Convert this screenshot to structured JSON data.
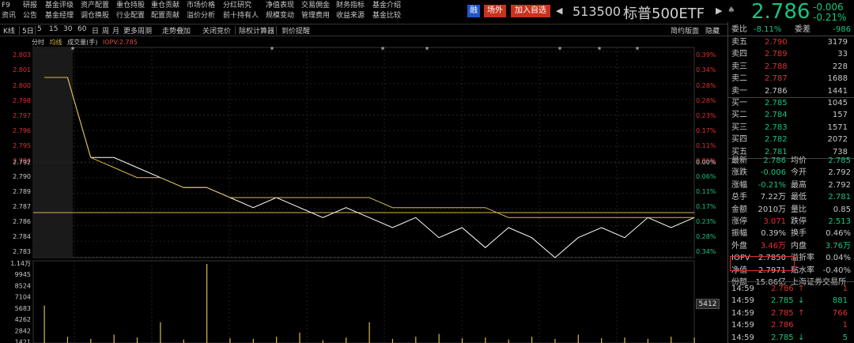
{
  "nav": {
    "row1": [
      "F9",
      "研报",
      "基金评级",
      "资产配置",
      "重仓持股",
      "重仓贡献",
      "市场价格",
      "分红研究",
      "净值表现",
      "交易佣金",
      "财务指标",
      "基金介绍"
    ],
    "row2": [
      "资讯",
      "公告",
      "基金经理",
      "调仓换股",
      "行业配置",
      "配置贡献",
      "溢价分析",
      "前十持有人",
      "规模变动",
      "管理费用",
      "收益来源",
      "基金比较"
    ]
  },
  "header": {
    "rong": "融",
    "changwai": "场外",
    "add_watch": "加入自选",
    "code": "513500",
    "name": "标普500ETF",
    "price": "2.786",
    "change": "-0.006",
    "change_pct": "-0.21%",
    "colors": {
      "up": "#e03030",
      "down": "#19c37d",
      "accent_blue": "#1e56c8",
      "accent_red": "#c8321e"
    }
  },
  "toolbar": {
    "items": [
      "K线",
      "5日",
      "5",
      "15",
      "30",
      "60",
      "日",
      "周",
      "月",
      "更多周期",
      "走势叠加",
      "关闭竞价",
      "除权计算器",
      "到价提醒"
    ],
    "right": [
      "简约版面",
      "隐藏"
    ]
  },
  "legend": {
    "fenshi": "分时",
    "junxian": "均线",
    "volume": "成交量(手)",
    "iopv": "IOPV:2.785"
  },
  "price_axis": {
    "left": [
      "2.803",
      "2.801",
      "2.800",
      "2.798",
      "2.797",
      "2.796",
      "2.795",
      "2.794",
      "2.792",
      "2.790",
      "2.789",
      "2.787",
      "2.786",
      "2.784",
      "2.783"
    ],
    "right": [
      "0.39%",
      "0.34%",
      "0.28%",
      "0.28%",
      "0.23%",
      "0.17%",
      "0.11%",
      "0.06%",
      "0.00%",
      "0.06%",
      "0.11%",
      "0.17%",
      "0.23%",
      "0.28%",
      "0.34%"
    ]
  },
  "volume_axis": {
    "labels": [
      "1.14万",
      "9945",
      "8524",
      "7104",
      "5683",
      "4262",
      "2842",
      "1421"
    ],
    "current": "5412"
  },
  "chart_data": {
    "type": "line",
    "title": "",
    "series": [
      {
        "name": "分时",
        "color": "#ffffff",
        "values": [
          2.8,
          2.8,
          2.792,
          2.792,
          2.791,
          2.79,
          2.789,
          2.789,
          2.788,
          2.787,
          2.788,
          2.787,
          2.786,
          2.787,
          2.786,
          2.785,
          2.786,
          2.784,
          2.785,
          2.783,
          2.785,
          2.784,
          2.782,
          2.784,
          2.785,
          2.784,
          2.786,
          2.785,
          2.786
        ]
      },
      {
        "name": "均线",
        "color": "#d8b84a",
        "values": [
          2.8,
          2.8,
          2.792,
          2.791,
          2.79,
          2.79,
          2.789,
          2.789,
          2.788,
          2.788,
          2.788,
          2.788,
          2.788,
          2.788,
          2.788,
          2.787,
          2.787,
          2.787,
          2.787,
          2.787,
          2.786,
          2.786,
          2.786,
          2.786,
          2.786,
          2.786,
          2.786,
          2.786,
          2.786
        ]
      }
    ],
    "ylim": [
      2.782,
      2.803
    ],
    "volume": [
      5412,
      900,
      600,
      1200,
      800,
      3000,
      500,
      11400,
      700,
      600,
      900,
      1500,
      400,
      800,
      3000,
      600,
      900,
      1300,
      700,
      800,
      500,
      900,
      600,
      1200,
      700,
      800,
      600,
      900,
      800
    ]
  },
  "orderbook": {
    "weibi": {
      "label": "委比",
      "value": "-8.11%"
    },
    "weicha": {
      "label": "委差",
      "value": "-986"
    },
    "asks": [
      {
        "label": "卖五",
        "price": "2.790",
        "vol": "3179"
      },
      {
        "label": "卖四",
        "price": "2.789",
        "vol": "33"
      },
      {
        "label": "卖三",
        "price": "2.788",
        "vol": "228"
      },
      {
        "label": "卖二",
        "price": "2.787",
        "vol": "1688"
      },
      {
        "label": "卖一",
        "price": "2.786",
        "vol": "1441"
      }
    ],
    "bids": [
      {
        "label": "买一",
        "price": "2.785",
        "vol": "1045"
      },
      {
        "label": "买二",
        "price": "2.784",
        "vol": "157"
      },
      {
        "label": "买三",
        "price": "2.783",
        "vol": "1571"
      },
      {
        "label": "买四",
        "price": "2.782",
        "vol": "2072"
      },
      {
        "label": "买五",
        "price": "2.781",
        "vol": "738"
      }
    ]
  },
  "stats": [
    {
      "l1": "最新",
      "v1": "2.786",
      "c1": "down",
      "l2": "均价",
      "v2": "2.785",
      "c2": "down"
    },
    {
      "l1": "涨跌",
      "v1": "-0.006",
      "c1": "down",
      "l2": "今开",
      "v2": "2.792",
      "c2": "plain"
    },
    {
      "l1": "涨幅",
      "v1": "-0.21%",
      "c1": "down",
      "l2": "最高",
      "v2": "2.792",
      "c2": "plain"
    },
    {
      "l1": "总手",
      "v1": "7.22万",
      "c1": "plain",
      "l2": "最低",
      "v2": "2.781",
      "c2": "down"
    },
    {
      "l1": "金额",
      "v1": "2010万",
      "c1": "plain",
      "l2": "量比",
      "v2": "0.85",
      "c2": "plain"
    },
    {
      "l1": "涨停",
      "v1": "3.071",
      "c1": "up",
      "l2": "跌停",
      "v2": "2.513",
      "c2": "down"
    },
    {
      "l1": "振幅",
      "v1": "0.39%",
      "c1": "plain",
      "l2": "换手",
      "v2": "0.46%",
      "c2": "plain"
    },
    {
      "l1": "外盘",
      "v1": "3.46万",
      "c1": "up",
      "l2": "内盘",
      "v2": "3.76万",
      "c2": "down"
    },
    {
      "l1": "IOPV",
      "v1": "2.7850",
      "c1": "plain",
      "l2": "溢折率",
      "v2": "0.04%",
      "c2": "plain"
    },
    {
      "l1": "净值",
      "v1": "2.7971",
      "c1": "plain",
      "l2": "贴水率",
      "v2": "-0.40%",
      "c2": "plain"
    },
    {
      "l1": "份额",
      "v1": "15.86亿",
      "c1": "plain",
      "l2": "上海证券交易所",
      "v2": "",
      "c2": "plain"
    }
  ],
  "ticks": [
    {
      "time": "14:59",
      "price": "2.786",
      "arrow": "↑",
      "vol": "1",
      "c": "up"
    },
    {
      "time": "14:59",
      "price": "2.785",
      "arrow": "↓",
      "vol": "881",
      "c": "down"
    },
    {
      "time": "14:59",
      "price": "2.785",
      "arrow": "↑",
      "vol": "766",
      "c": "up"
    },
    {
      "time": "14:59",
      "price": "2.786",
      "arrow": "",
      "vol": "1",
      "c": "up"
    },
    {
      "time": "14:59",
      "price": "2.785",
      "arrow": "↓",
      "vol": "5",
      "c": "down"
    }
  ]
}
